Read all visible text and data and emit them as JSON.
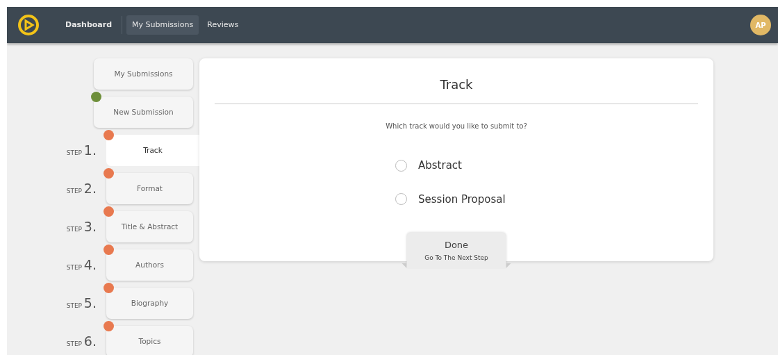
{
  "navbar": {
    "items": [
      {
        "label": "Dashboard",
        "selected": false,
        "bold": true
      },
      {
        "label": "My Submissions",
        "selected": true,
        "bold": false
      },
      {
        "label": "Reviews",
        "selected": false,
        "bold": false
      }
    ],
    "avatar": "AP"
  },
  "sidebar": {
    "items": [
      {
        "label": "My Submissions"
      },
      {
        "label": "New Submission",
        "color": "#6e8f3a"
      }
    ],
    "steps": [
      {
        "prefix": "STEP",
        "number": "1.",
        "label": "Track",
        "selected": true,
        "color": "#e8794f"
      },
      {
        "prefix": "STEP",
        "number": "2.",
        "label": "Format",
        "selected": false,
        "color": "#e8794f"
      },
      {
        "prefix": "STEP",
        "number": "3.",
        "label": "Title & Abstract",
        "selected": false,
        "color": "#e8794f"
      },
      {
        "prefix": "STEP",
        "number": "4.",
        "label": "Authors",
        "selected": false,
        "color": "#e8794f"
      },
      {
        "prefix": "STEP",
        "number": "5.",
        "label": "Biography",
        "selected": false,
        "color": "#e8794f"
      },
      {
        "prefix": "STEP",
        "number": "6.",
        "label": "Topics",
        "selected": false,
        "color": "#e8794f"
      }
    ]
  },
  "card": {
    "title": "Track",
    "question": "Which track would you like to submit to?",
    "options": [
      {
        "label": "Abstract",
        "selected": false
      },
      {
        "label": "Session Proposal",
        "selected": false
      }
    ],
    "done_button": {
      "label": "Done",
      "sublabel": "Go To The Next Step"
    }
  }
}
